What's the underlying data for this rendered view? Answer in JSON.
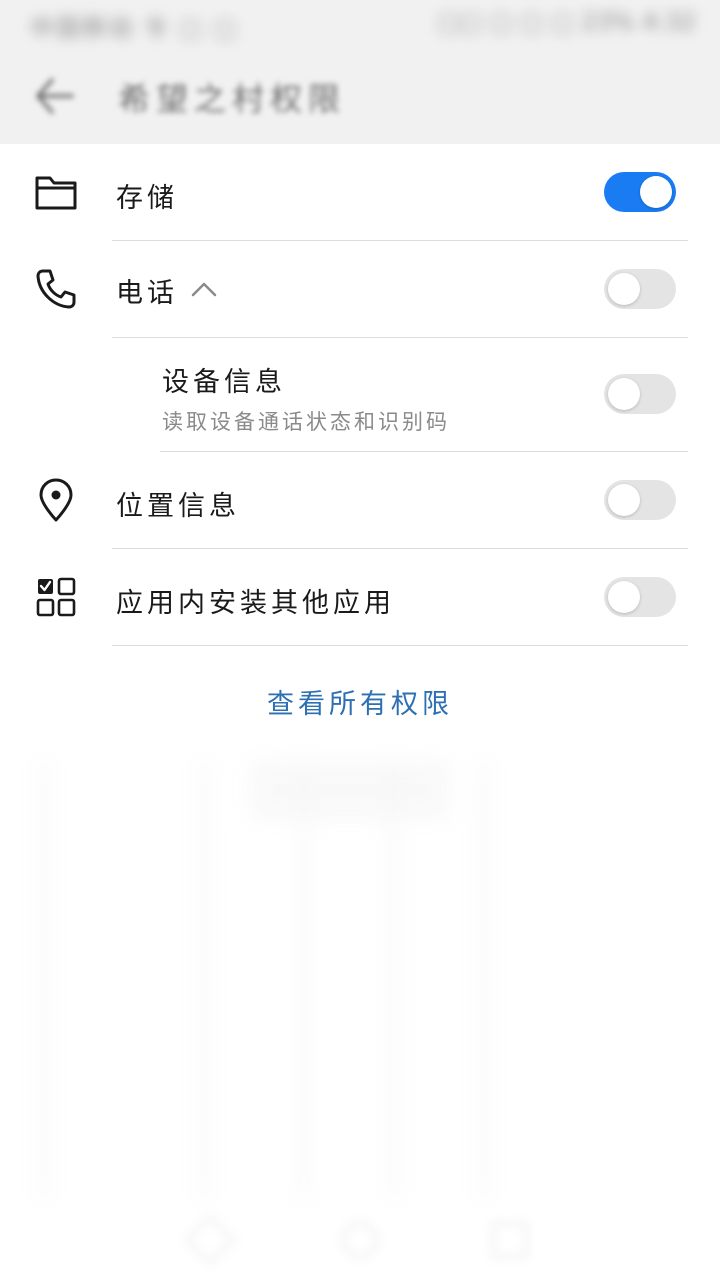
{
  "status_bar": {
    "left_text": "中国移动 令 ▢ ▢",
    "right_text": "▢▢ ▢ ▢ ▢ 23% 4:32"
  },
  "app_bar": {
    "back_icon": "arrow-left-icon",
    "title": "希望之村权限"
  },
  "permissions": [
    {
      "id": "storage",
      "icon": "folder-icon",
      "label": "存储",
      "enabled": true
    },
    {
      "id": "phone",
      "icon": "phone-icon",
      "label": "电话",
      "expanded": true,
      "enabled": false,
      "children": [
        {
          "id": "device-info",
          "title": "设备信息",
          "description": "读取设备通话状态和识别码",
          "enabled": false
        }
      ]
    },
    {
      "id": "location",
      "icon": "location-pin-icon",
      "label": "位置信息",
      "enabled": false
    },
    {
      "id": "install-apps",
      "icon": "apps-grid-icon",
      "label": "应用内安装其他应用",
      "enabled": false
    }
  ],
  "view_all_label": "查看所有权限",
  "colors": {
    "toggle_on": "#1a7cf2",
    "toggle_off": "#e4e4e4",
    "link": "#2d6fb2",
    "header_bg": "#f1f1f1"
  }
}
